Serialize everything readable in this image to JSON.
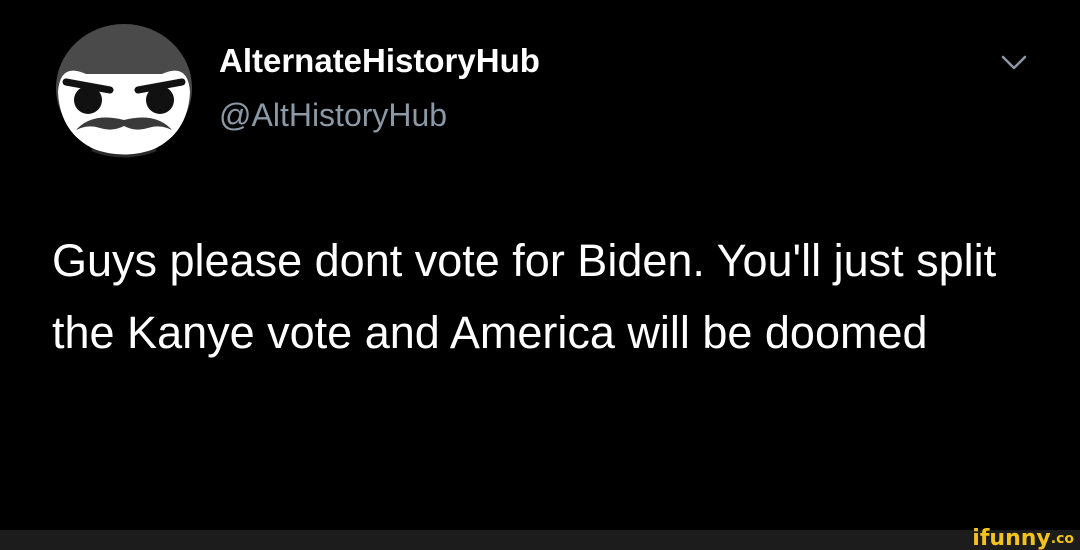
{
  "tweet": {
    "display_name": "AlternateHistoryHub",
    "handle": "@AltHistoryHub",
    "text": "Guys please dont vote for Biden. You'll just split the Kanye vote and America will be doomed",
    "avatar_icon": "mustached-face-avatar",
    "menu_icon": "chevron-down-icon"
  },
  "watermark": {
    "text": "ifunny",
    "suffix": ".co",
    "color": "#f3c21c"
  },
  "colors": {
    "background": "#000000",
    "primary_text": "#ffffff",
    "secondary_text": "#8b98a5"
  }
}
